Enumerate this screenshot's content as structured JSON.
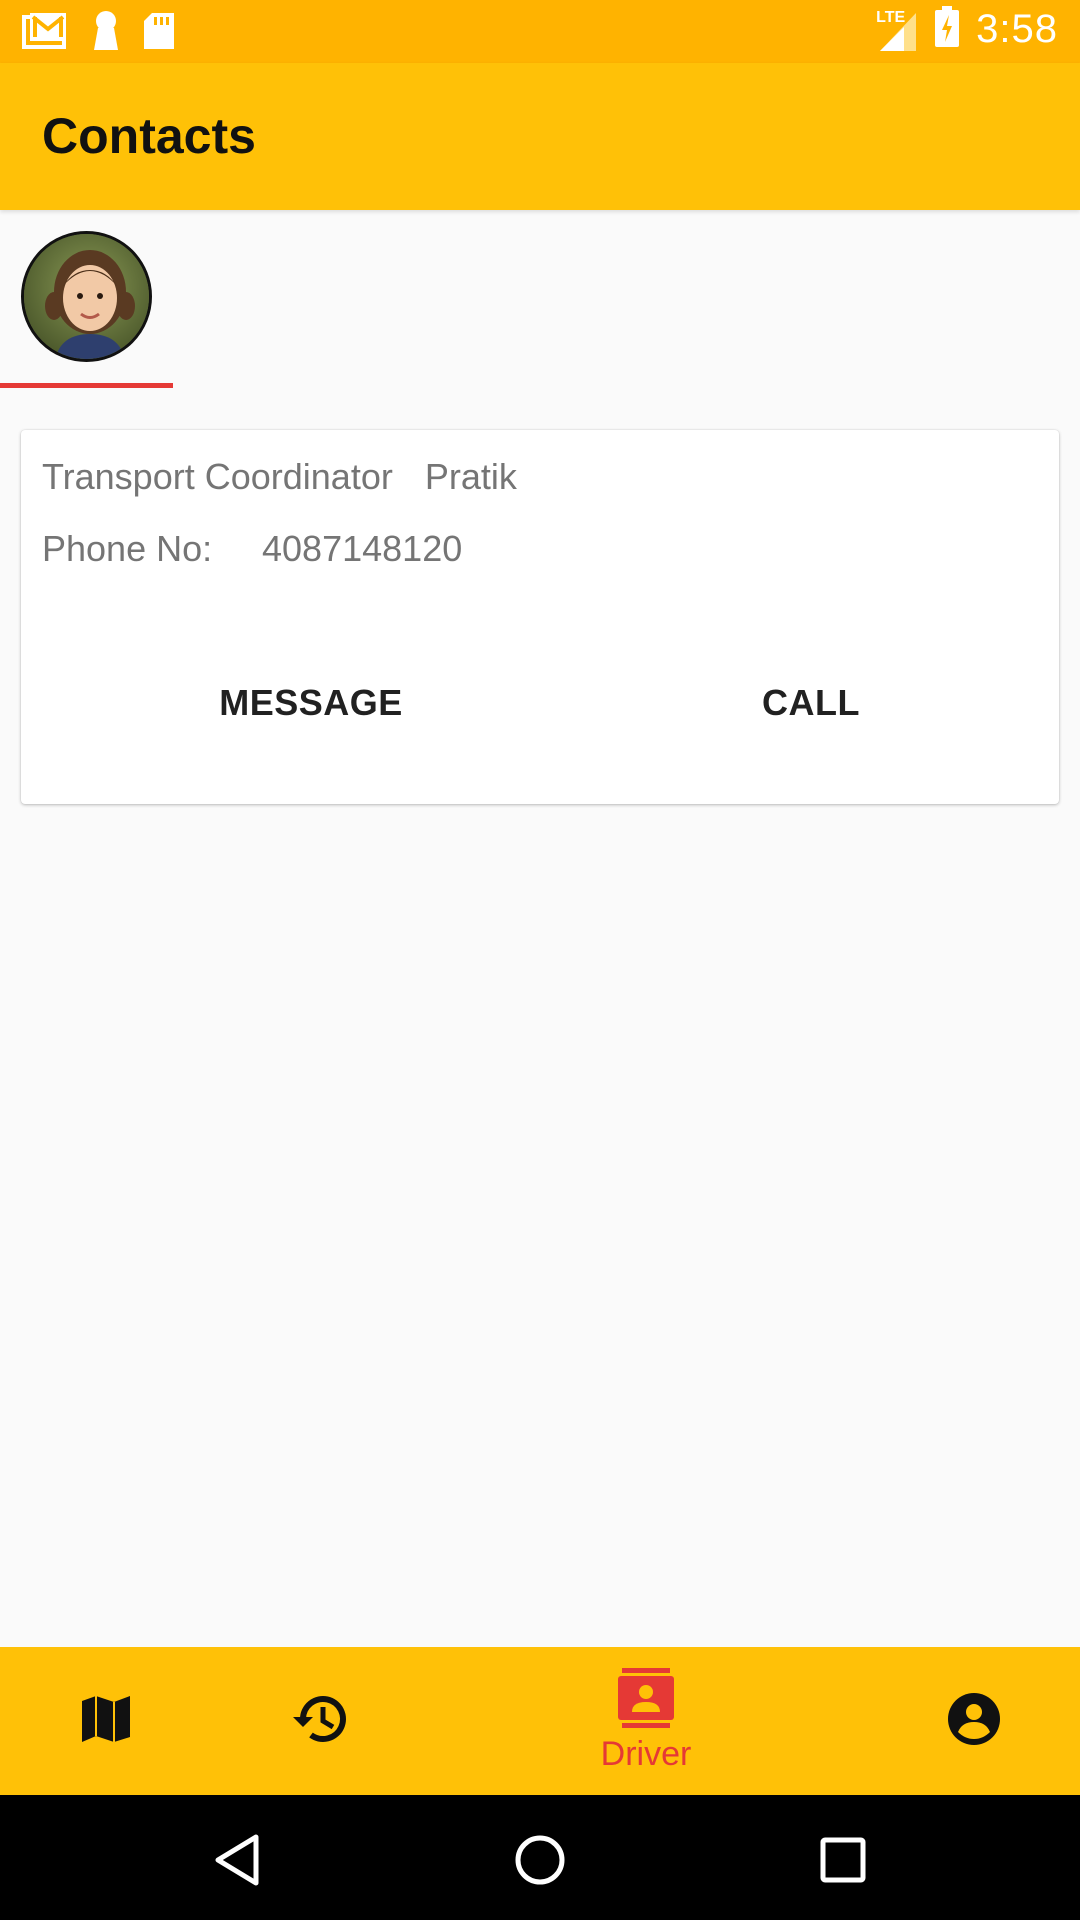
{
  "status_bar": {
    "time": "3:58",
    "network": "LTE",
    "icons": [
      "gmail-icon",
      "keyhole-icon",
      "sd-card-icon",
      "signal-icon",
      "battery-charging-icon"
    ]
  },
  "app_bar": {
    "title": "Contacts"
  },
  "contact": {
    "role_label": "Transport Coordinator",
    "name": "Pratik",
    "phone_label": "Phone No:",
    "phone": "4087148120",
    "message_label": "MESSAGE",
    "call_label": "CALL"
  },
  "bottom_nav": {
    "items": [
      {
        "icon": "map-icon",
        "label": ""
      },
      {
        "icon": "history-icon",
        "label": ""
      },
      {
        "icon": "contact-card-icon",
        "label": "Driver"
      },
      {
        "icon": "account-circle-icon",
        "label": ""
      }
    ],
    "active_index": 2
  },
  "colors": {
    "status_bar": "#ffb300",
    "app_bar": "#ffc107",
    "accent": "#e53935",
    "background": "#fafafa"
  }
}
